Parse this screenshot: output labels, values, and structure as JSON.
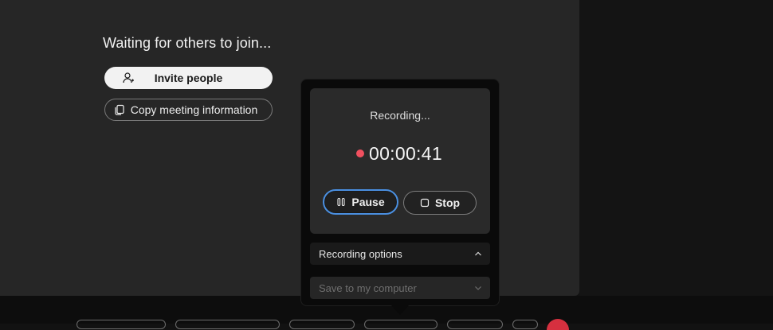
{
  "meeting": {
    "waiting_text": "Waiting for others to join...",
    "invite_label": "Invite people",
    "copy_label": "Copy meeting information"
  },
  "recording": {
    "status": "Recording...",
    "elapsed": "00:00:41",
    "pause_label": "Pause",
    "stop_label": "Stop",
    "options_label": "Recording options",
    "save_target": "Save to my computer"
  },
  "icons": {
    "invite": "person-add-icon",
    "copy": "copy-icon",
    "recording_dot": "record-dot-icon",
    "pause": "pause-icon",
    "stop": "stop-icon",
    "options": "chevron-up-icon",
    "save": "chevron-down-icon"
  },
  "colors": {
    "recording_dot": "#f0505f",
    "focus_ring": "#4a8fe0",
    "end_button": "#d6303f"
  }
}
